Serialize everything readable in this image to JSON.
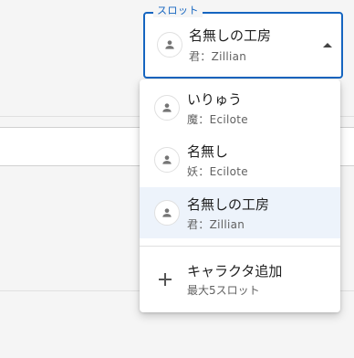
{
  "slot_field": {
    "label": "スロット",
    "selected": {
      "name": "名無しの工房",
      "sub": "君：Zillian",
      "icon": "person-icon"
    },
    "caret_icon": "caret-up-icon"
  },
  "menu": {
    "items": [
      {
        "name": "いりゅう",
        "sub": "魔：Ecilote",
        "icon": "person-icon",
        "selected": false
      },
      {
        "name": "名無し",
        "sub": "妖：Ecilote",
        "icon": "person-icon",
        "selected": false
      },
      {
        "name": "名無しの工房",
        "sub": "君：Zillian",
        "icon": "person-icon",
        "selected": true
      }
    ],
    "add": {
      "label": "キャラクタ追加",
      "sub": "最大5スロット",
      "icon": "plus-icon"
    }
  },
  "colors": {
    "accent": "#1565c0",
    "selected_bg": "#edf3fb"
  }
}
